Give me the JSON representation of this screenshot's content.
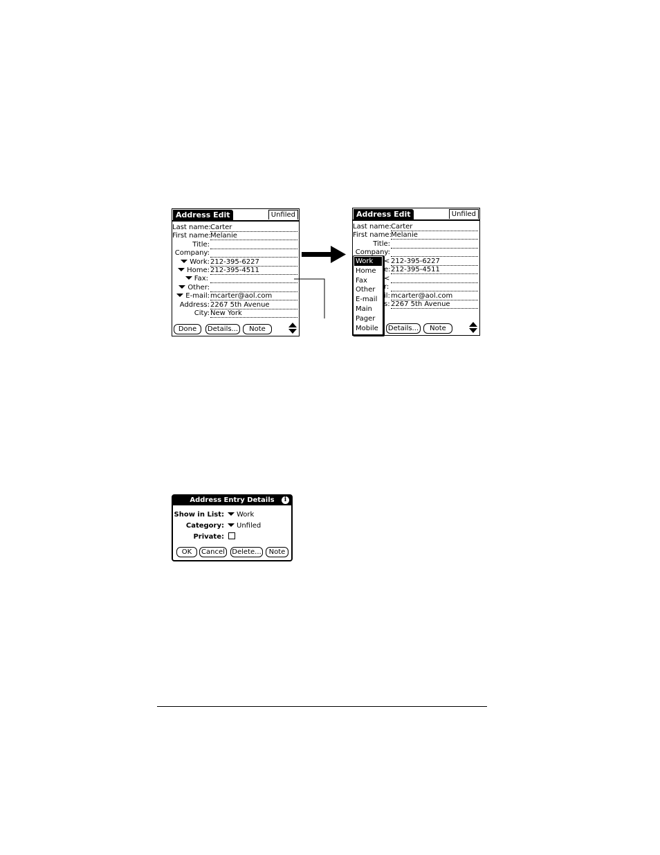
{
  "left_screen": {
    "title": "Address Edit",
    "category": "Unfiled",
    "fields": [
      {
        "label": "Last name:",
        "value": "Carter",
        "dropdown": false
      },
      {
        "label": "First name:",
        "value": "Melanie",
        "dropdown": false
      },
      {
        "label": "Title:",
        "value": "",
        "dropdown": false
      },
      {
        "label": "Company:",
        "value": "",
        "dropdown": false
      },
      {
        "label": "Work:",
        "value": "212-395-6227",
        "dropdown": true
      },
      {
        "label": "Home:",
        "value": "212-395-4511",
        "dropdown": true
      },
      {
        "label": "Fax:",
        "value": "",
        "dropdown": true
      },
      {
        "label": "Other:",
        "value": "",
        "dropdown": true
      },
      {
        "label": "E-mail:",
        "value": "mcarter@aol.com",
        "dropdown": true
      },
      {
        "label": "Address:",
        "value": "2267 5th Avenue",
        "dropdown": false
      },
      {
        "label": "City:",
        "value": "New York",
        "dropdown": false
      }
    ],
    "buttons": {
      "done": "Done",
      "details": "Details...",
      "note": "Note"
    }
  },
  "right_screen": {
    "title": "Address Edit",
    "category": "Unfiled",
    "fields": [
      {
        "label": "Last name:",
        "value": "Carter"
      },
      {
        "label": "First name:",
        "value": "Melanie"
      },
      {
        "label": "Title:",
        "value": ""
      },
      {
        "label": "Company:",
        "value": ""
      }
    ],
    "partial_rows": [
      {
        "label": "<",
        "value": "212-395-6227"
      },
      {
        "label": "e:",
        "value": "212-395-4511"
      },
      {
        "label": "<",
        "value": ""
      },
      {
        "label": "r:",
        "value": ""
      },
      {
        "label": "il:",
        "value": "mcarter@aol.com"
      },
      {
        "label": "s:",
        "value": "2267 5th Avenue"
      }
    ],
    "popup_items": [
      "Work",
      "Home",
      "Fax",
      "Other",
      "E-mail",
      "Main",
      "Pager",
      "Mobile"
    ],
    "popup_selected": "Work",
    "buttons": {
      "details": "Details...",
      "note": "Note"
    }
  },
  "details_dialog": {
    "title": "Address Entry Details",
    "show_in_list_label": "Show in List:",
    "show_in_list_value": "Work",
    "category_label": "Category:",
    "category_value": "Unfiled",
    "private_label": "Private:",
    "private_checked": false,
    "buttons": {
      "ok": "OK",
      "cancel": "Cancel",
      "delete": "Delete...",
      "note": "Note"
    }
  }
}
